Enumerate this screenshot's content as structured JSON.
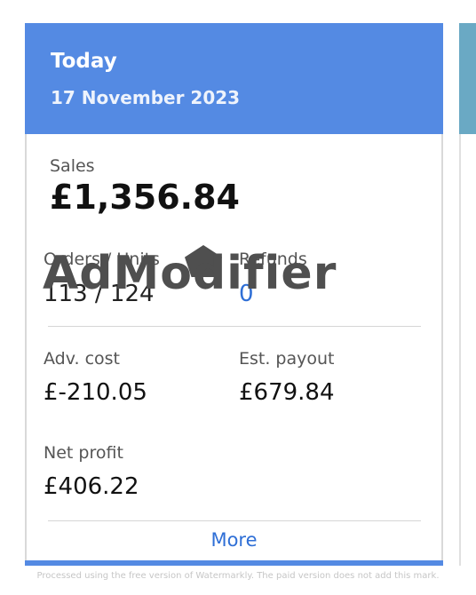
{
  "header": {
    "title": "Today",
    "date": "17 November 2023"
  },
  "sales": {
    "label": "Sales",
    "value": "£1,356.84"
  },
  "orders_units": {
    "label": "Orders / Units",
    "value": "113 / 124"
  },
  "refunds": {
    "label": "Refunds",
    "value": "0"
  },
  "adv_cost": {
    "label": "Adv. cost",
    "value": "£-210.05"
  },
  "est_payout": {
    "label": "Est. payout",
    "value": "£679.84"
  },
  "net_profit": {
    "label": "Net profit",
    "value": "£406.22"
  },
  "more_label": "More",
  "watermark": "AdModifier",
  "footer_note": "Processed using the free version of Watermarkly. The paid version does not add this mark.",
  "colors": {
    "header_bg": "#548ae3",
    "link": "#2f6fd6",
    "side_card": "#6aa9c4"
  }
}
